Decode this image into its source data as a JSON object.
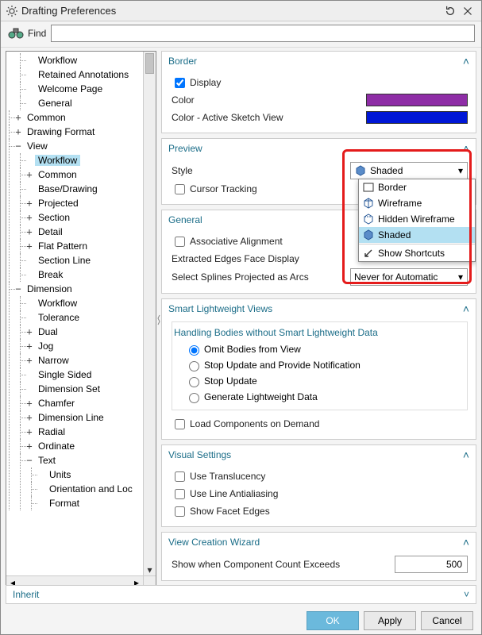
{
  "title": "Drafting Preferences",
  "find": {
    "label": "Find",
    "value": ""
  },
  "tree": {
    "top": [
      {
        "label": "Workflow"
      },
      {
        "label": "Retained Annotations"
      },
      {
        "label": "Welcome Page"
      },
      {
        "label": "General"
      }
    ],
    "common": {
      "toggle": "+",
      "label": "Common"
    },
    "drawing_format": {
      "toggle": "+",
      "label": "Drawing Format"
    },
    "view": {
      "toggle": "−",
      "label": "View",
      "children": [
        {
          "toggle": "",
          "label": "Workflow",
          "selected": true
        },
        {
          "toggle": "+",
          "label": "Common"
        },
        {
          "toggle": "",
          "label": "Base/Drawing"
        },
        {
          "toggle": "+",
          "label": "Projected"
        },
        {
          "toggle": "+",
          "label": "Section"
        },
        {
          "toggle": "+",
          "label": "Detail"
        },
        {
          "toggle": "+",
          "label": "Flat Pattern"
        },
        {
          "toggle": "",
          "label": "Section Line"
        },
        {
          "toggle": "",
          "label": "Break"
        }
      ]
    },
    "dimension": {
      "toggle": "−",
      "label": "Dimension",
      "children": [
        {
          "toggle": "",
          "label": "Workflow"
        },
        {
          "toggle": "",
          "label": "Tolerance"
        },
        {
          "toggle": "+",
          "label": "Dual"
        },
        {
          "toggle": "+",
          "label": "Jog"
        },
        {
          "toggle": "+",
          "label": "Narrow"
        },
        {
          "toggle": "",
          "label": "Single Sided"
        },
        {
          "toggle": "",
          "label": "Dimension Set"
        },
        {
          "toggle": "+",
          "label": "Chamfer"
        },
        {
          "toggle": "+",
          "label": "Dimension Line"
        },
        {
          "toggle": "+",
          "label": "Radial"
        },
        {
          "toggle": "+",
          "label": "Ordinate"
        },
        {
          "toggle": "−",
          "label": "Text",
          "children": [
            {
              "label": "Units"
            },
            {
              "label": "Orientation and Loc"
            },
            {
              "label": "Format"
            }
          ]
        }
      ]
    }
  },
  "sections": {
    "border": {
      "title": "Border",
      "display_label": "Display",
      "display_checked": true,
      "color_label": "Color",
      "color_value": "#8e2da6",
      "color_active_label": "Color - Active Sketch View",
      "color_active_value": "#0016d6"
    },
    "preview": {
      "title": "Preview",
      "style_label": "Style",
      "style_value": "Shaded",
      "cursor_label": "Cursor Tracking",
      "cursor_checked": false,
      "options": [
        {
          "icon": "border-icon",
          "label": "Border"
        },
        {
          "icon": "wireframe-icon",
          "label": "Wireframe"
        },
        {
          "icon": "hidden-wireframe-icon",
          "label": "Hidden Wireframe"
        },
        {
          "icon": "shaded-icon",
          "label": "Shaded",
          "selected": true
        },
        {
          "icon": "shortcut-icon",
          "label": "Show Shortcuts"
        }
      ]
    },
    "general": {
      "title": "General",
      "assoc_label": "Associative Alignment",
      "assoc_checked": false,
      "extracted_label": "Extracted Edges Face Display",
      "splines_label": "Select Splines Projected as Arcs",
      "splines_value": "Never for Automatic"
    },
    "smart": {
      "title": "Smart Lightweight Views",
      "sub_title": "Handling Bodies without Smart Lightweight Data",
      "radios": [
        {
          "label": "Omit Bodies from View",
          "checked": true
        },
        {
          "label": "Stop Update and Provide Notification",
          "checked": false
        },
        {
          "label": "Stop Update",
          "checked": false
        },
        {
          "label": "Generate Lightweight Data",
          "checked": false
        }
      ],
      "load_label": "Load Components on Demand",
      "load_checked": false
    },
    "visual": {
      "title": "Visual Settings",
      "translucency_label": "Use Translucency",
      "translucency_checked": false,
      "antialias_label": "Use Line Antialiasing",
      "antialias_checked": false,
      "facet_label": "Show Facet Edges",
      "facet_checked": false
    },
    "wizard": {
      "title": "View Creation Wizard",
      "show_label": "Show when Component Count Exceeds",
      "count_value": "500"
    }
  },
  "inherit": {
    "label": "Inherit"
  },
  "buttons": {
    "ok": "OK",
    "apply": "Apply",
    "cancel": "Cancel"
  }
}
